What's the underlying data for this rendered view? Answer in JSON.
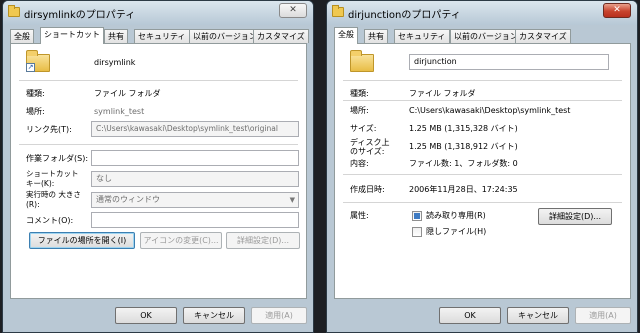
{
  "windows": [
    {
      "title": "dirsymlinkのプロパティ",
      "close_glyph": "✕",
      "tabs": [
        "全般",
        "ショートカット",
        "共有",
        "セキュリティ",
        "以前のバージョン",
        "カスタマイズ"
      ],
      "name": "dirsymlink",
      "rows": [
        {
          "label": "種類:",
          "value": "ファイル フォルダ"
        },
        {
          "label": "場所:",
          "value": "symlink_test"
        },
        {
          "label": "リンク先(T):",
          "value": "C:\\Users\\kawasaki\\Desktop\\symlink_test\\original"
        }
      ],
      "fields": [
        {
          "label": "作業フォルダ(S):",
          "value": ""
        },
        {
          "label": "ショートカット キー(K):",
          "value": "なし"
        },
        {
          "label": "実行時の 大きさ(R):",
          "value": "通常のウィンドウ"
        },
        {
          "label": "コメント(O):",
          "value": ""
        }
      ],
      "buttons": {
        "open_location": "ファイルの場所を開く(I)",
        "change_icon": "アイコンの変更(C)...",
        "advanced": "詳細設定(D)..."
      },
      "footer": {
        "ok": "OK",
        "cancel": "キャンセル",
        "apply": "適用(A)"
      }
    },
    {
      "title": "dirjunctionのプロパティ",
      "close_glyph": "✕",
      "tabs": [
        "全般",
        "共有",
        "セキュリティ",
        "以前のバージョン",
        "カスタマイズ"
      ],
      "name": "dirjunction",
      "rows": [
        {
          "label": "種類:",
          "value": "ファイル フォルダ"
        },
        {
          "label": "場所:",
          "value": "C:\\Users\\kawasaki\\Desktop\\symlink_test"
        },
        {
          "label": "サイズ:",
          "value": "1.25 MB (1,315,328 バイト)"
        },
        {
          "label": "ディスク上 のサイズ:",
          "value": "1.25 MB (1,318,912 バイト)"
        },
        {
          "label": "内容:",
          "value": "ファイル数: 1、フォルダ数: 0"
        },
        {
          "label": "作成日時:",
          "value": "2006年11月28日、17:24:35"
        },
        {
          "label": "属性:",
          "value": ""
        }
      ],
      "attributes": [
        {
          "label": "読み取り専用(R)",
          "state": "indeterminate"
        },
        {
          "label": "隠しファイル(H)",
          "state": "unchecked"
        }
      ],
      "buttons": {
        "advanced": "詳細設定(D)..."
      },
      "footer": {
        "ok": "OK",
        "cancel": "キャンセル",
        "apply": "適用(A)"
      }
    }
  ]
}
